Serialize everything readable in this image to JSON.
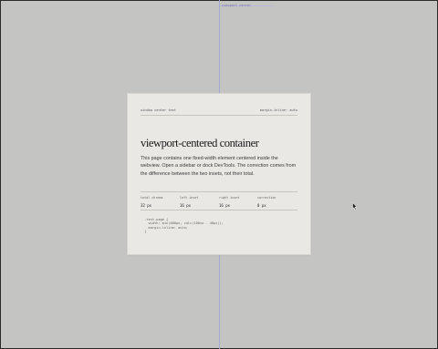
{
  "viewport": {
    "guide_label": "viewport center",
    "background": "#c4c4c2",
    "guide_color": "#a7a9d2",
    "cursor_icon": "arrow-cursor"
  },
  "card": {
    "caption_left": "window center test",
    "caption_right": "margin-inline: auto",
    "title": "viewport-centered container",
    "description": "This page contains one fixed-width element centered inside the webview. Open a sidebar or dock DevTools. The correction comes from the difference between the two insets, not their total.",
    "stats": [
      {
        "label": "total chrome",
        "value": "32 px"
      },
      {
        "label": "left inset",
        "value": "16 px"
      },
      {
        "label": "right inset",
        "value": "16 px"
      },
      {
        "label": "correction",
        "value": "0 px"
      }
    ],
    "code": "  .test-page {\n    width: min(600px, calc(100vw - 48px));\n    margin-inline: auto;\n  }"
  }
}
